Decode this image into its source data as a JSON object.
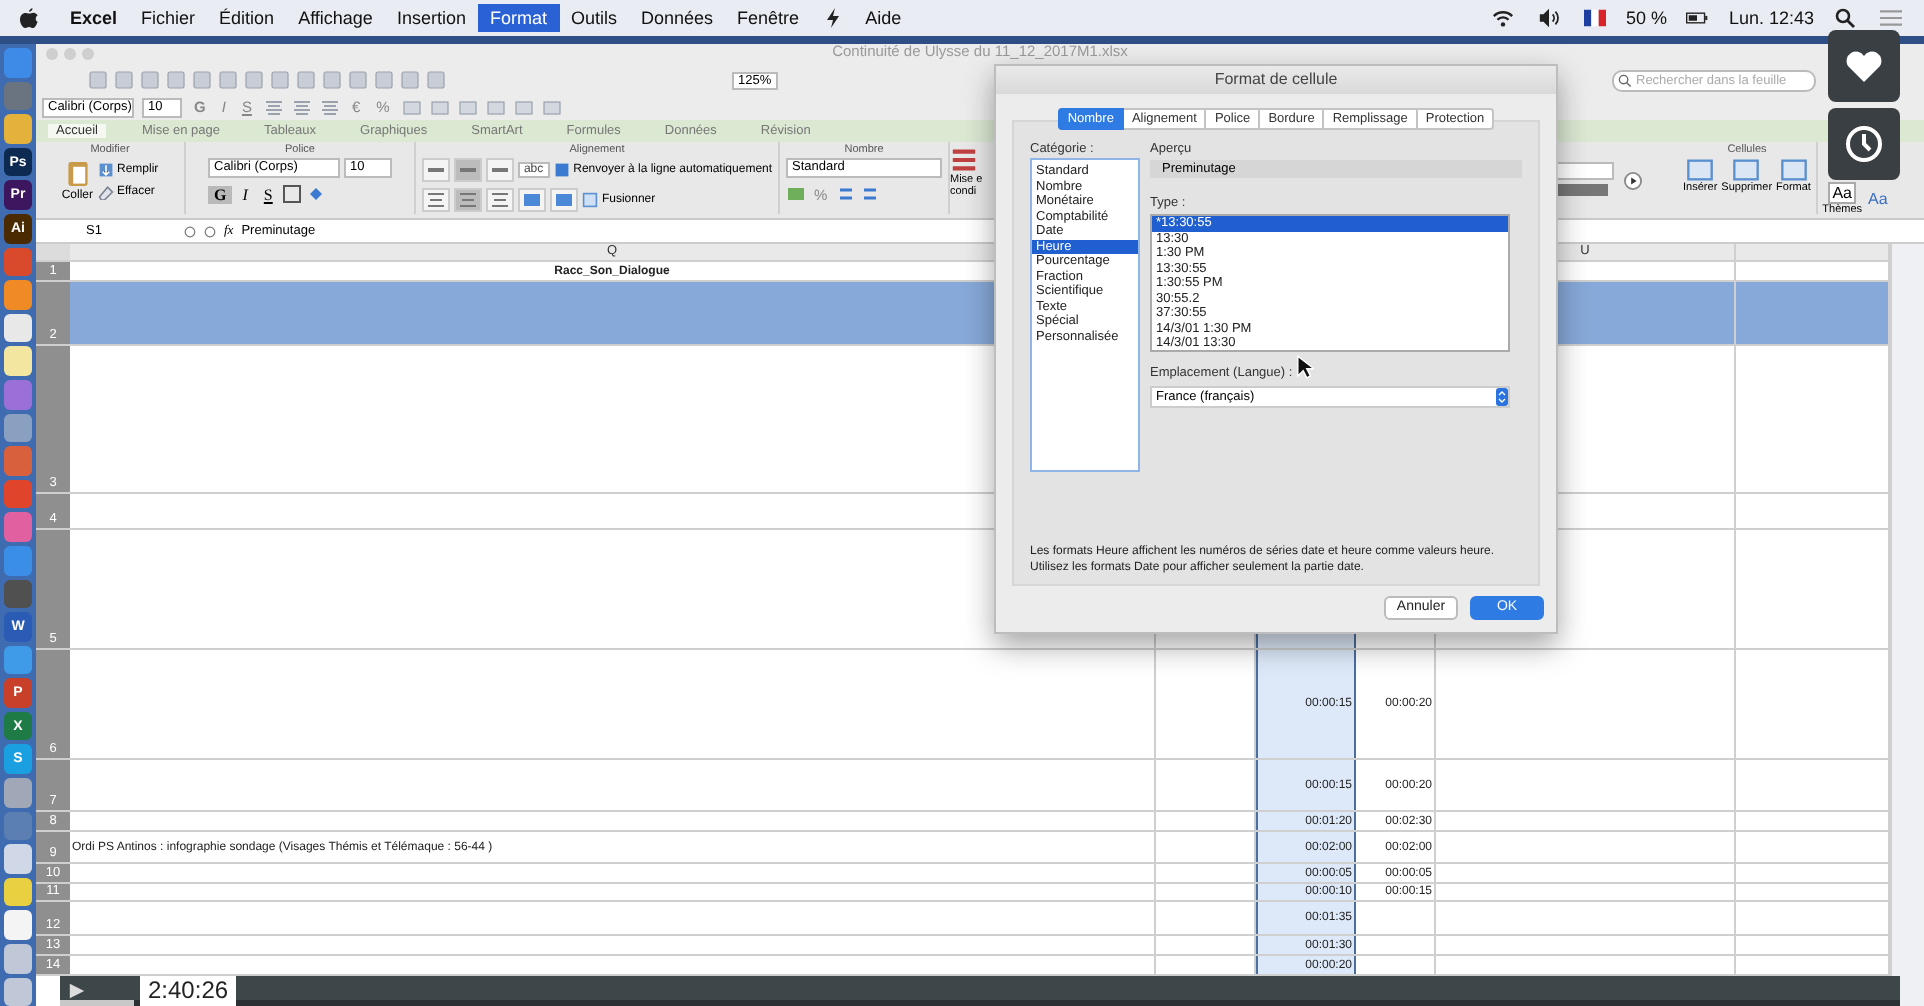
{
  "menu_bar": {
    "items": [
      {
        "label": "Excel",
        "selected": false
      },
      {
        "label": "Fichier",
        "selected": false
      },
      {
        "label": "Édition",
        "selected": false
      },
      {
        "label": "Affichage",
        "selected": false
      },
      {
        "label": "Insertion",
        "selected": false
      },
      {
        "label": "Format",
        "selected": true
      },
      {
        "label": "Outils",
        "selected": false
      },
      {
        "label": "Données",
        "selected": false
      },
      {
        "label": "Fenêtre",
        "selected": false
      },
      {
        "label": "Aide",
        "selected": false
      }
    ],
    "battery": "50 %",
    "clock": "Lun. 12:43"
  },
  "dock": [
    {
      "color": "#3d8be6"
    },
    {
      "color": "#6a7380"
    },
    {
      "color": "#e4b23a"
    },
    {
      "label": "Ps",
      "color": "#0d2a52"
    },
    {
      "label": "Pr",
      "color": "#3d1660"
    },
    {
      "label": "Ai",
      "color": "#4a2a00"
    },
    {
      "color": "#d94a2c"
    },
    {
      "color": "#f08a24"
    },
    {
      "color": "#e8e8e8"
    },
    {
      "color": "#f2e6a0"
    },
    {
      "color": "#9b6fd8"
    },
    {
      "color": "#8aa0c0"
    },
    {
      "color": "#d8603c"
    },
    {
      "color": "#e0452c"
    },
    {
      "color": "#e060a0"
    },
    {
      "color": "#3a8ee6"
    },
    {
      "color": "#505050"
    },
    {
      "label": "W",
      "color": "#2a5bb5"
    },
    {
      "color": "#3f9be8"
    },
    {
      "label": "P",
      "color": "#c8402a"
    },
    {
      "label": "X",
      "color": "#1e7b45"
    },
    {
      "label": "S",
      "color": "#1aa0e0"
    },
    {
      "color": "#a0a8b8"
    },
    {
      "color": "#5a7fb0"
    },
    {
      "color": "#d0d8e8"
    },
    {
      "color": "#e8d040"
    },
    {
      "color": "#f4f4f4"
    },
    {
      "color": "#c0c8d8"
    },
    {
      "color": "#c0c8d8"
    }
  ],
  "window": {
    "title": "Continuité de Ulysse du 11_12_2017M1.xlsx",
    "zoom": "125%",
    "search": {
      "placeholder": "Rechercher dans la feuille"
    }
  },
  "format_bar": {
    "font": "Calibri (Corps)",
    "size": "10",
    "styles": [
      "G",
      "I",
      "S"
    ],
    "currency": "€",
    "percent": "%"
  },
  "ribbon": {
    "tabs": [
      {
        "label": "Accueil",
        "selected": true
      },
      {
        "label": "Mise en page",
        "selected": false
      },
      {
        "label": "Tableaux",
        "selected": false
      },
      {
        "label": "Graphiques",
        "selected": false
      },
      {
        "label": "SmartArt",
        "selected": false
      },
      {
        "label": "Formules",
        "selected": false
      },
      {
        "label": "Données",
        "selected": false
      },
      {
        "label": "Révision",
        "selected": false
      }
    ],
    "modifier": {
      "title": "Modifier",
      "paste": "Coller",
      "fill": "Remplir",
      "clear": "Effacer"
    },
    "police": {
      "title": "Police",
      "font": "Calibri (Corps)",
      "size": "10",
      "styles": [
        {
          "label": "G",
          "selected": true
        },
        {
          "label": "I",
          "selected": false
        },
        {
          "label": "S",
          "selected": false
        }
      ]
    },
    "alignement": {
      "title": "Alignement",
      "abc": "abc",
      "wrap": "Renvoyer à la ligne automatiquement",
      "merge": "Fusionner"
    },
    "nombre": {
      "title": "Nombre",
      "format": "Standard",
      "percent": "%"
    },
    "conditional": [
      "Mise e",
      "condi"
    ],
    "cellules": {
      "title": "Cellules",
      "buttons": [
        "Insérer",
        "Supprimer",
        "Format"
      ]
    },
    "themes": {
      "label": "Thèmes",
      "glyphs": [
        "Aa",
        "Aa"
      ]
    }
  },
  "formula_bar": {
    "cell": "S1",
    "fx": "fx",
    "value": "Preminutage"
  },
  "sheet": {
    "columns": [
      {
        "label": "Q",
        "selected": false
      },
      {
        "selected": false
      },
      {
        "selected": true
      },
      {
        "selected": false
      },
      {
        "label": "U",
        "selected": false
      },
      {
        "selected": false
      }
    ],
    "rows": [
      {
        "number": "1",
        "highlighted": false,
        "q": "Racc_Son_Dialogue"
      },
      {
        "number": "2",
        "highlighted": true
      },
      {
        "number": "3",
        "highlighted": false
      },
      {
        "number": "4",
        "highlighted": false
      },
      {
        "number": "5",
        "highlighted": false
      },
      {
        "number": "6",
        "highlighted": false,
        "s": "00:00:15",
        "t": "00:00:20"
      },
      {
        "number": "7",
        "highlighted": false,
        "s": "00:00:15",
        "t": "00:00:20"
      },
      {
        "number": "8",
        "highlighted": false,
        "s": "00:01:20",
        "t": "00:02:30"
      },
      {
        "number": "9",
        "highlighted": false,
        "q": "Ordi PS Antinos : infographie sondage (Visages Thémis et Télémaque : 56-44 )",
        "s": "00:02:00",
        "t": "00:02:00"
      },
      {
        "number": "10",
        "highlighted": false,
        "s": "00:00:05",
        "t": "00:00:05"
      },
      {
        "number": "11",
        "highlighted": false,
        "s": "00:00:10",
        "t": "00:00:15"
      },
      {
        "number": "12",
        "highlighted": false,
        "s": "00:01:35"
      },
      {
        "number": "13",
        "highlighted": false,
        "s": "00:01:30"
      },
      {
        "number": "14",
        "highlighted": false,
        "s": "00:00:20"
      }
    ]
  },
  "dialog": {
    "title": "Format de cellule",
    "tabs": [
      {
        "label": "Nombre",
        "selected": true
      },
      {
        "label": "Alignement",
        "selected": false
      },
      {
        "label": "Police",
        "selected": false
      },
      {
        "label": "Bordure",
        "selected": false
      },
      {
        "label": "Remplissage",
        "selected": false
      },
      {
        "label": "Protection",
        "selected": false
      }
    ],
    "category_label": "Catégorie :",
    "categories": [
      {
        "label": "Standard",
        "selected": false
      },
      {
        "label": "Nombre",
        "selected": false
      },
      {
        "label": "Monétaire",
        "selected": false
      },
      {
        "label": "Comptabilité",
        "selected": false
      },
      {
        "label": "Date",
        "selected": false
      },
      {
        "label": "Heure",
        "selected": true
      },
      {
        "label": "Pourcentage",
        "selected": false
      },
      {
        "label": "Fraction",
        "selected": false
      },
      {
        "label": "Scientifique",
        "selected": false
      },
      {
        "label": "Texte",
        "selected": false
      },
      {
        "label": "Spécial",
        "selected": false
      },
      {
        "label": "Personnalisée",
        "selected": false
      }
    ],
    "preview_label": "Aperçu",
    "preview": "Preminutage",
    "type_label": "Type :",
    "types": [
      {
        "label": "*13:30:55",
        "selected": true
      },
      {
        "label": "13:30",
        "selected": false
      },
      {
        "label": "1:30 PM",
        "selected": false
      },
      {
        "label": "13:30:55",
        "selected": false
      },
      {
        "label": "1:30:55 PM",
        "selected": false
      },
      {
        "label": "30:55.2",
        "selected": false
      },
      {
        "label": "37:30:55",
        "selected": false
      },
      {
        "label": "14/3/01 1:30 PM",
        "selected": false
      },
      {
        "label": "14/3/01 13:30",
        "selected": false
      }
    ],
    "locale_label": "Emplacement (Langue) :",
    "locale": "France (français)",
    "description": "Les formats Heure affichent les numéros de séries date et heure comme valeurs heure. Utilisez les formats Date pour afficher seulement la partie date.",
    "buttons": [
      {
        "label": "Annuler",
        "kind": "cancel"
      },
      {
        "label": "OK",
        "kind": "default"
      }
    ]
  },
  "video": {
    "time": "2:40:26",
    "level": 0.04
  }
}
